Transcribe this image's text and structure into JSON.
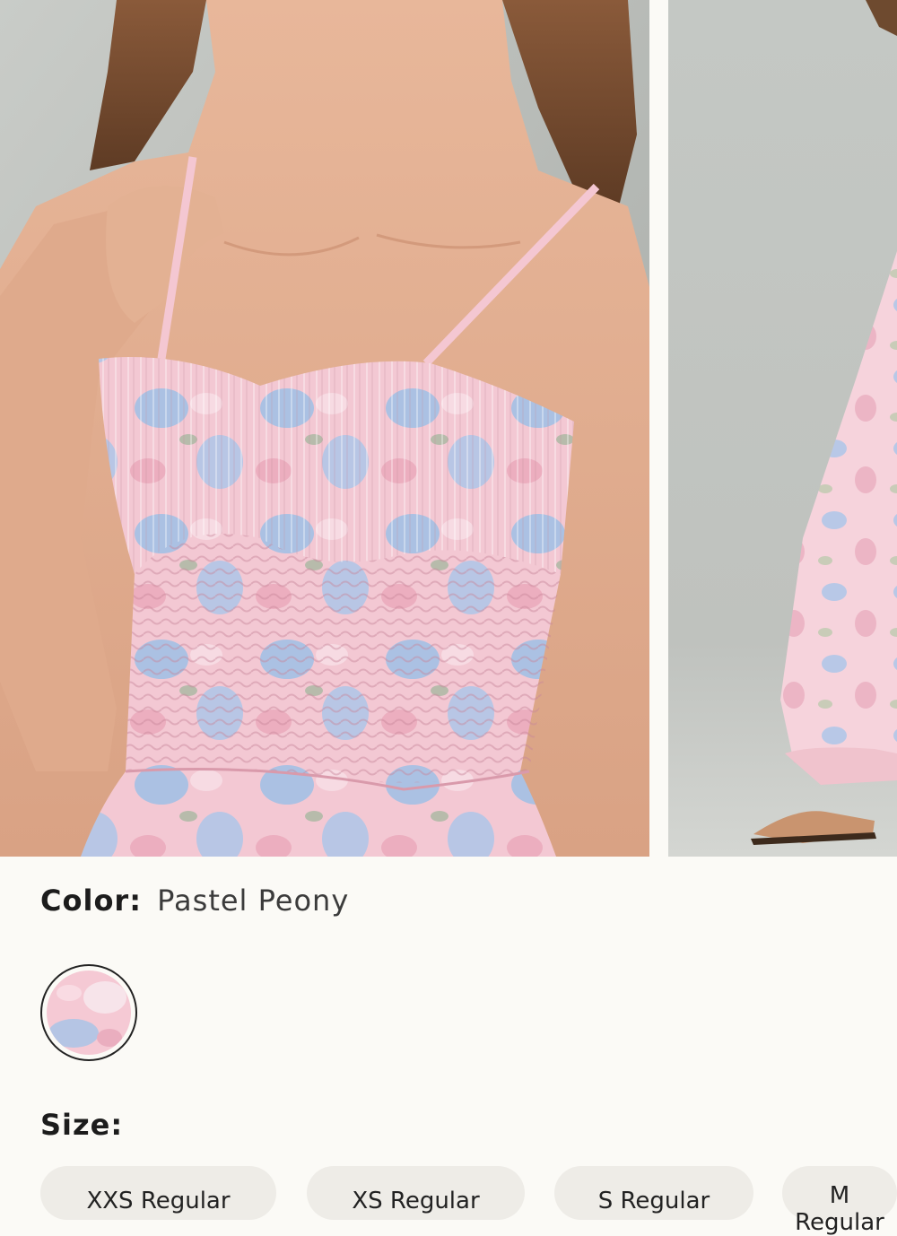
{
  "product": {
    "images": [
      {
        "icon": "model-closeup-photo"
      },
      {
        "icon": "model-full-length-photo"
      }
    ],
    "color": {
      "label": "Color:",
      "value": "Pastel Peony",
      "swatch_colors": [
        "#f5c9d4",
        "#a9c4e6",
        "#f7e4ea"
      ]
    },
    "size": {
      "label": "Size:",
      "options": [
        "XXS Regular",
        "XS Regular",
        "S Regular",
        "M Regular"
      ]
    }
  },
  "colors": {
    "background": "#fbfaf6",
    "chip": "#eeece7",
    "text": "#1c1c1c"
  }
}
